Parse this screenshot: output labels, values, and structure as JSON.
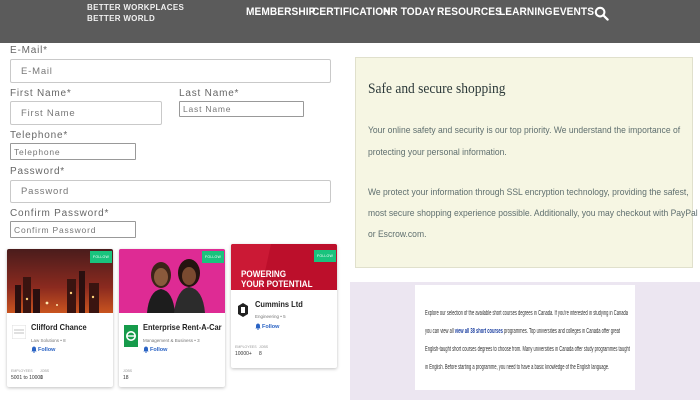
{
  "nav": {
    "brand_line1": "BETTER WORKPLACES",
    "brand_line2": "BETTER WORLD",
    "items": [
      "MEMBERSHIP",
      "CERTIFICATION",
      "HR TODAY",
      "RESOURCES",
      "LEARNING",
      "EVENTS"
    ]
  },
  "form": {
    "email_label": "E-Mail*",
    "email_placeholder": "E-Mail",
    "first_name_label": "First Name*",
    "first_name_placeholder": "First Name",
    "last_name_label": "Last Name*",
    "last_name_placeholder": "Last Name",
    "telephone_label": "Telephone*",
    "telephone_placeholder": "Telephone",
    "password_label": "Password*",
    "password_placeholder": "Password",
    "confirm_label": "Confirm Password*",
    "confirm_placeholder": "Confirm Password"
  },
  "cards": [
    {
      "name": "Clifford Chance",
      "sub": "Law Solutions • 8",
      "follow": "Follow",
      "badge": "FOLLOW",
      "stat1_label": "EMPLOYEES",
      "stat1_value": "5001 to 10000",
      "stat2_label": "JOBS",
      "stat2_value": "1"
    },
    {
      "name": "Enterprise Rent-A-Car",
      "sub": "Management & Business • 3",
      "follow": "Follow",
      "badge": "FOLLOW",
      "stat1_label": "JOBS",
      "stat1_value": "18"
    },
    {
      "name": "Cummins Ltd",
      "sub": "Engineering • 5",
      "follow": "Follow",
      "badge": "FOLLOW",
      "img_text1": "POWERING",
      "img_text2": "YOUR POTENTIAL",
      "stat1_label": "EMPLOYEES",
      "stat1_value": "10000+",
      "stat2_label": "JOBS",
      "stat2_value": "8"
    }
  ],
  "safe": {
    "title": "Safe and secure shopping",
    "p1_line1": "Your online safety and security is our top priority. We understand the importance of",
    "p1_line2": "protecting your personal information.",
    "p2_line1": "We protect your information through SSL encryption technology, providing the safest,",
    "p2_line2": "most secure shopping experience possible. Additionally, you may checkout with PayPal",
    "p2_line3": "or Escrow.com."
  },
  "promo": {
    "line1": "Explore our selection of the available short courses degrees in Canada. If you're interested in studying in Canada",
    "line2_a": "you can view all ",
    "line2_link": "view all 38 short courses",
    "line2_b": " programmes. Top universities and colleges in Canada offer great",
    "line3": "English-taught short courses degrees to choose from. Many universities in Canada offer study programmes taught",
    "line4": "in English. Before starting a programme, you need to have a basic knowledge of the English language."
  }
}
